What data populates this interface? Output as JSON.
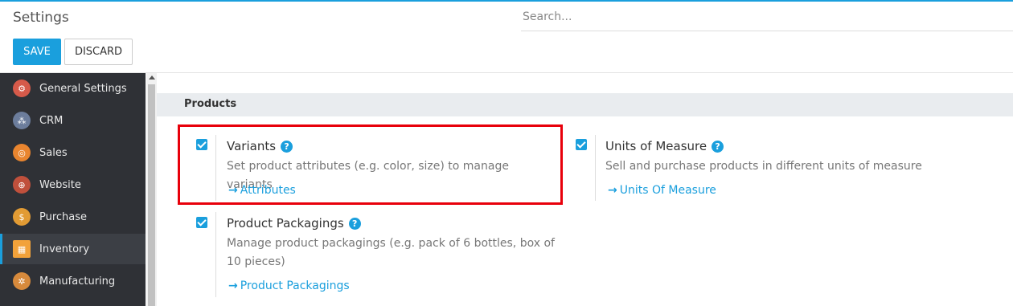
{
  "header": {
    "title": "Settings",
    "search_placeholder": "Search...",
    "save_label": "SAVE",
    "discard_label": "DISCARD"
  },
  "sidebar": {
    "items": [
      {
        "label": "General Settings",
        "icon": "general-settings-icon",
        "color": "#d65a4a"
      },
      {
        "label": "CRM",
        "icon": "crm-icon",
        "color": "#6c7d9c"
      },
      {
        "label": "Sales",
        "icon": "sales-icon",
        "color": "#e9852f"
      },
      {
        "label": "Website",
        "icon": "website-icon",
        "color": "#c0503c"
      },
      {
        "label": "Purchase",
        "icon": "purchase-icon",
        "color": "#e29b34"
      },
      {
        "label": "Inventory",
        "icon": "inventory-icon",
        "color": "#f2a23a"
      },
      {
        "label": "Manufacturing",
        "icon": "manufacturing-icon",
        "color": "#d78a3c"
      }
    ],
    "active": "Inventory"
  },
  "section": {
    "title": "Products"
  },
  "settings": {
    "variants": {
      "title": "Variants",
      "description": "Set product attributes (e.g. color, size) to manage variants",
      "link": "Attributes",
      "checked": true
    },
    "units_of_measure": {
      "title": "Units of Measure",
      "description": "Sell and purchase products in different units of measure",
      "link": "Units Of Measure",
      "checked": true
    },
    "product_packagings": {
      "title": "Product Packagings",
      "description": "Manage product packagings (e.g. pack of 6 bottles, box of 10 pieces)",
      "link": "Product Packagings",
      "checked": true
    }
  },
  "colors": {
    "accent": "#1a9fdd",
    "highlight": "#e8000b",
    "sidebar_bg": "#2f3136"
  }
}
